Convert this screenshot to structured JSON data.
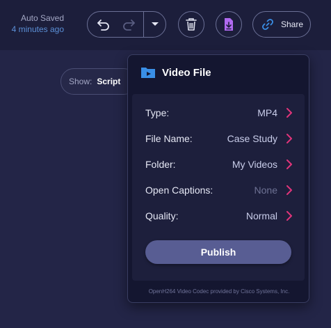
{
  "autosave": {
    "line1": "Auto Saved",
    "line2": "4 minutes ago"
  },
  "toolbar": {
    "share_label": "Share"
  },
  "show": {
    "label": "Show:",
    "value": "Script"
  },
  "popup": {
    "title": "Video File",
    "rows": [
      {
        "label": "Type:",
        "value": "MP4",
        "value_dim": false
      },
      {
        "label": "File Name:",
        "value": "Case Study",
        "value_dim": false
      },
      {
        "label": "Folder:",
        "value": "My Videos",
        "value_dim": false
      },
      {
        "label": "Open Captions:",
        "value": "None",
        "value_dim": true
      },
      {
        "label": "Quality:",
        "value": "Normal",
        "value_dim": false
      }
    ],
    "publish_label": "Publish",
    "footer": "OpenH264 Video Codec provided by Cisco Systems, Inc."
  },
  "colors": {
    "accent_chevron": "#e0347a",
    "accent_blue": "#3a8fe6",
    "download_icon": "#b06af0",
    "publish_button": "#585d93"
  },
  "icons": {
    "undo": "undo-icon",
    "redo": "redo-icon",
    "dropdown": "chevron-down-icon",
    "delete": "trash-icon",
    "download": "download-icon",
    "share": "link-icon",
    "video_folder": "video-folder-icon",
    "row_arrow": "chevron-right-icon"
  }
}
